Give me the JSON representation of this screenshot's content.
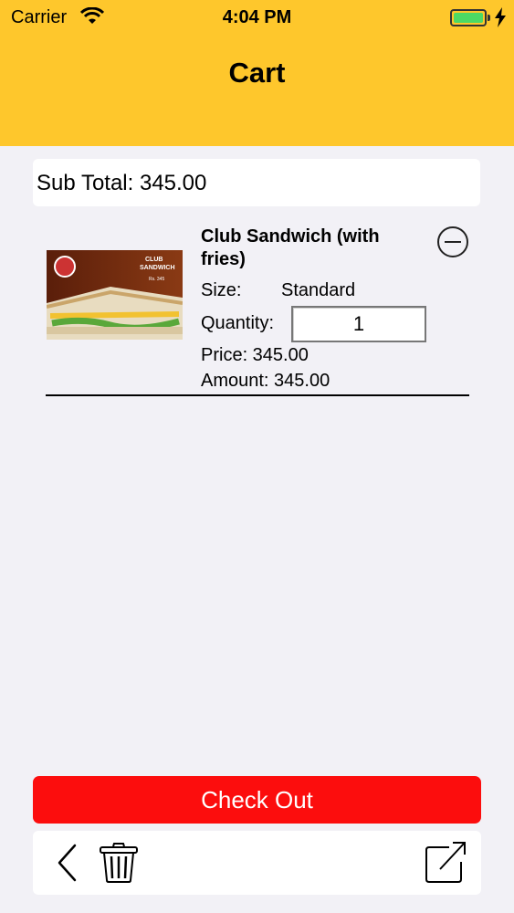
{
  "status_bar": {
    "carrier": "Carrier",
    "time": "4:04 PM",
    "icons": [
      "wifi-icon",
      "battery-icon",
      "charging-bolt-icon"
    ],
    "battery_color": "#4cd964"
  },
  "header": {
    "title": "Cart",
    "background": "#fec72c"
  },
  "cart": {
    "subtotal": "Sub Total: 345.00",
    "items": [
      {
        "name": "Club Sandwich (with fries)",
        "size_label": "Size:",
        "size_value": "Standard",
        "quantity_label": "Quantity:",
        "quantity": "1",
        "price": "Price: 345.00",
        "amount": "Amount: 345.00",
        "image": {
          "banner_line1": "CLUB",
          "banner_line2": "SANDWICH",
          "banner_price": "Rs. 345"
        }
      }
    ]
  },
  "actions": {
    "checkout_label": "Check Out",
    "checkout_color": "#fc0d0d",
    "toolbar_icons": [
      "back-icon",
      "trash-icon",
      "share-icon"
    ]
  }
}
